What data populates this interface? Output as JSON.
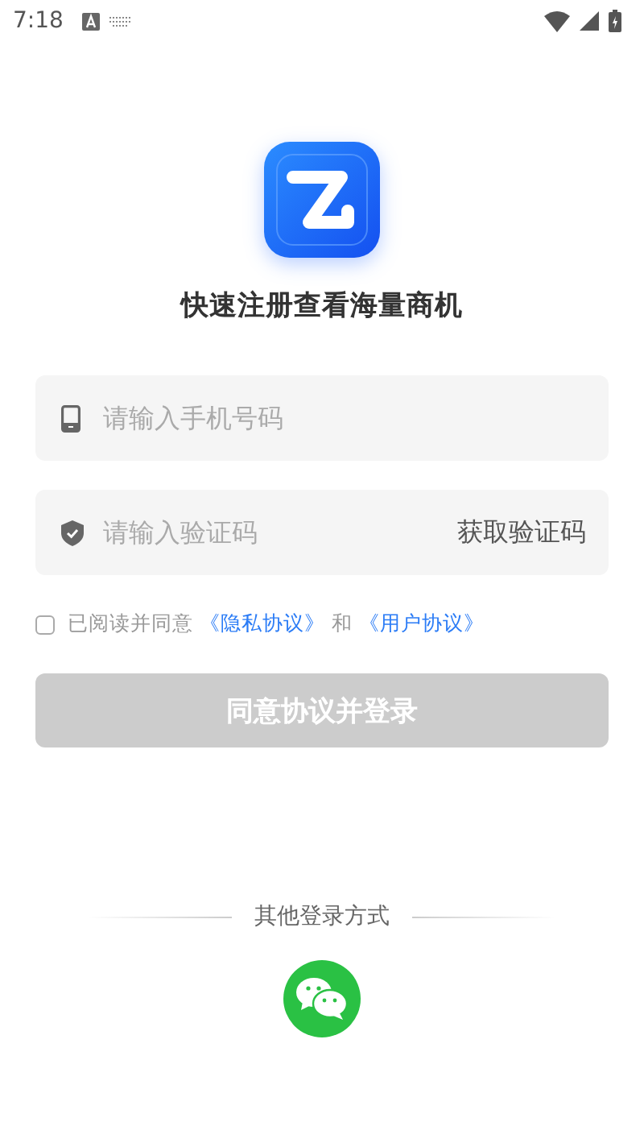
{
  "status_bar": {
    "time": "7:18"
  },
  "title": "快速注册查看海量商机",
  "phone_field": {
    "placeholder": "请输入手机号码"
  },
  "code_field": {
    "placeholder": "请输入验证码",
    "action": "获取验证码"
  },
  "agreement": {
    "checked": false,
    "prefix": "已阅读并同意",
    "link_1": "《隐私协议》",
    "joiner": "和",
    "link_2": "《用户协议》"
  },
  "login_button": {
    "label": "同意协议并登录",
    "disabled": true
  },
  "other_login": {
    "label": "其他登录方式"
  }
}
